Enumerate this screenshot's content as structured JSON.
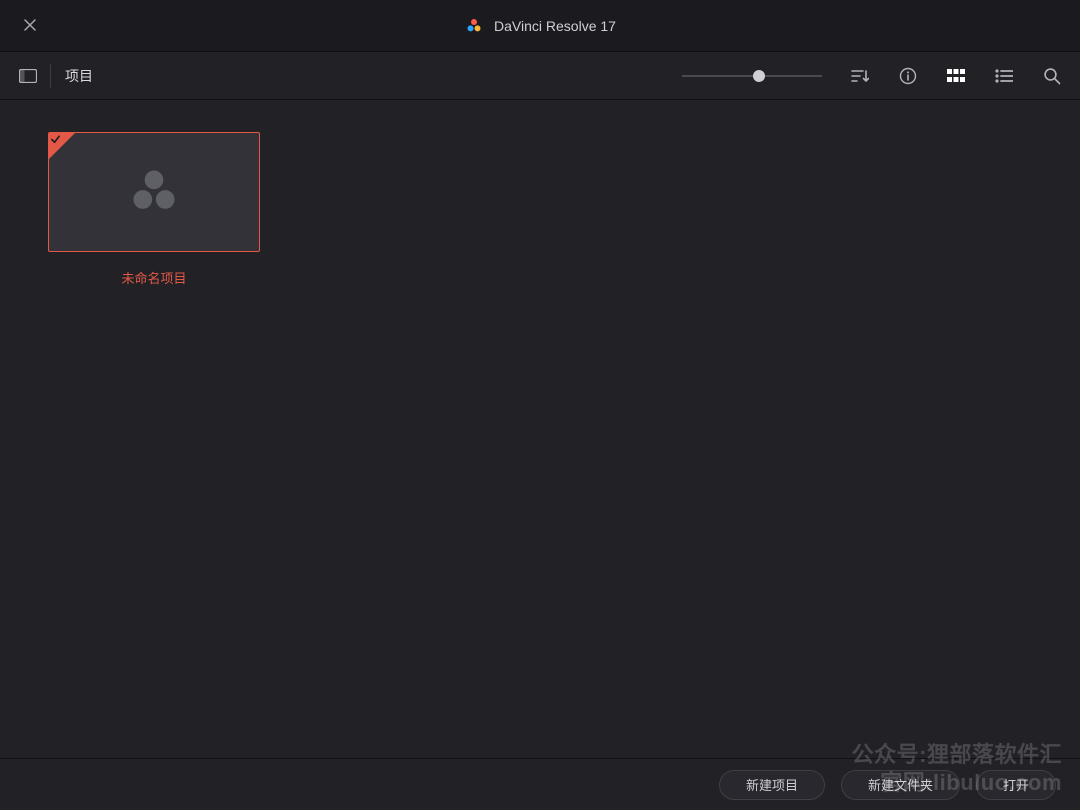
{
  "title": "DaVinci Resolve 17",
  "toolbar": {
    "breadcrumb": "项目",
    "zoom_percent": 55
  },
  "projects": [
    {
      "name": "未命名项目",
      "selected": true
    }
  ],
  "footer": {
    "new_project": "新建项目",
    "new_folder": "新建文件夹",
    "open": "打开"
  },
  "watermark": {
    "line1": "公众号:狸部落软件汇",
    "line2": "官网:libuluo.com"
  },
  "colors": {
    "accent": "#e45848",
    "bg": "#212126"
  }
}
